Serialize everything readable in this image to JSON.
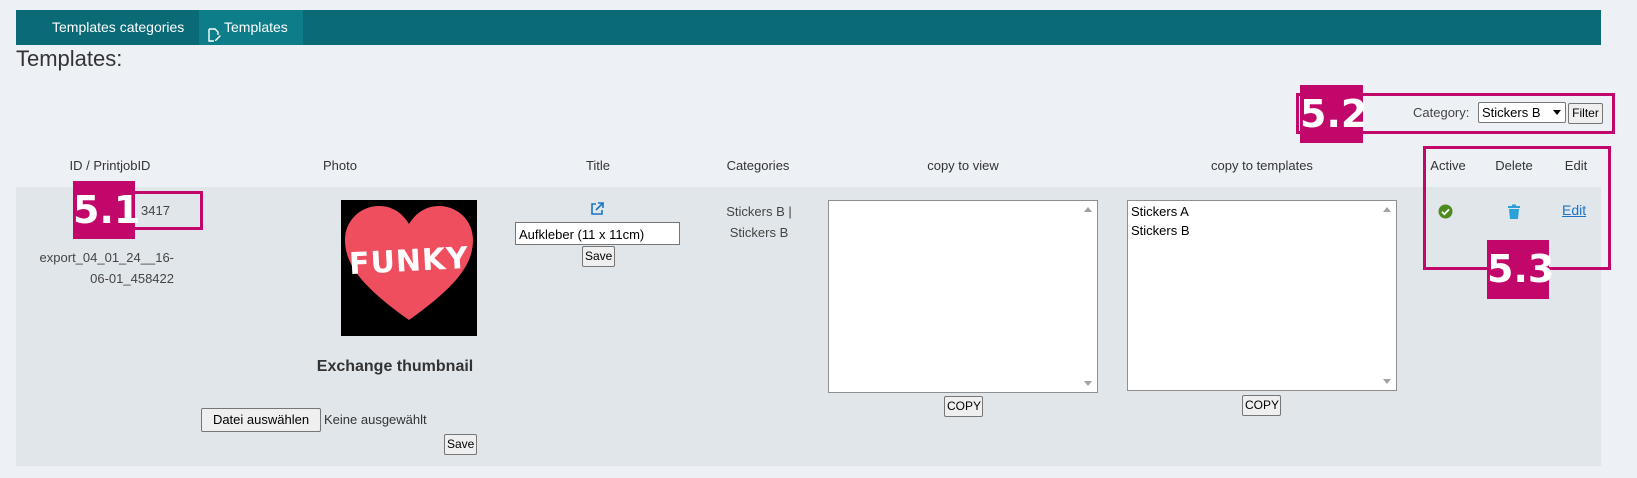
{
  "nav": {
    "items": [
      {
        "label": "Templates categories"
      },
      {
        "label": "Templates"
      }
    ]
  },
  "page_title": "Templates:",
  "filter": {
    "label": "Category:",
    "selected": "Stickers B",
    "button": "Filter"
  },
  "table": {
    "headers": {
      "id": "ID / PrintjobID",
      "photo": "Photo",
      "title": "Title",
      "categories": "Categories",
      "copy_to_view": "copy to view",
      "copy_to_templates": "copy to templates",
      "active": "Active",
      "delete": "Delete",
      "edit": "Edit"
    },
    "row": {
      "id": "3417",
      "printjob_line1": "export_04_01_24__16-",
      "printjob_line2": "06-01_458422",
      "photo_text": "FUNKY",
      "exchange_label": "Exchange thumbnail",
      "file_button": "Datei auswählen",
      "file_status": "Keine ausgewählt",
      "photo_save": "Save",
      "title_value": "Aufkleber (11 x 11cm)",
      "title_save": "Save",
      "categories_line1": "Stickers B |",
      "categories_line2": "Stickers B",
      "copy_to_view_options": [],
      "copy_to_view_button": "COPY",
      "copy_to_templates_options": [
        "Stickers A",
        "Stickers B"
      ],
      "copy_to_templates_button": "COPY",
      "edit_link": "Edit"
    }
  },
  "annotations": {
    "a1": "5.1",
    "a2": "5.2",
    "a3": "5.3"
  },
  "colors": {
    "nav_bg": "#0a6a76",
    "accent": "#c2076a",
    "link": "#1a73c8",
    "heart": "#ef4e5e",
    "active_green": "#4c8c1e",
    "trash_blue": "#2b9fd8"
  }
}
